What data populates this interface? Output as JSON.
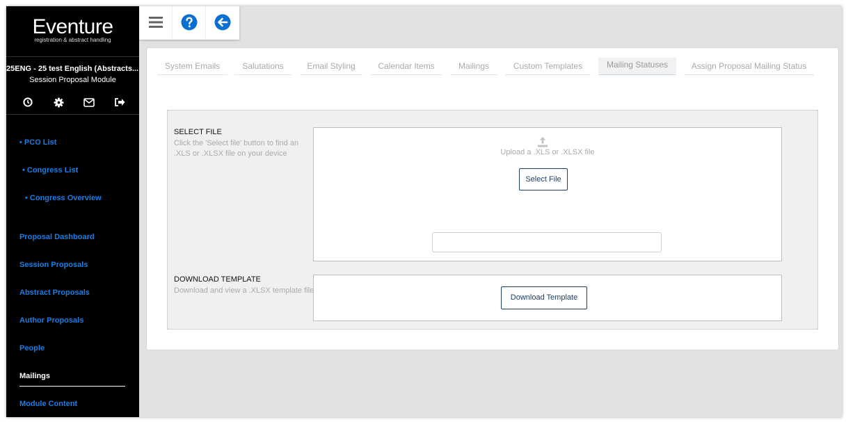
{
  "brand": {
    "name": "Eventure",
    "tagline": "registration & abstract handling"
  },
  "sidebar": {
    "congress": "25ENG - 25 test English (Abstracts...",
    "module": "Session Proposal Module",
    "icons": [
      "clock-icon",
      "gear-icon",
      "envelope-icon",
      "logout-icon"
    ],
    "nav": [
      {
        "label": "• PCO List"
      },
      {
        "label": "• Congress List"
      },
      {
        "label": "• Congress Overview"
      },
      {
        "label": "Proposal Dashboard"
      },
      {
        "label": "Session Proposals"
      },
      {
        "label": "Abstract Proposals"
      },
      {
        "label": "Author Proposals"
      },
      {
        "label": "People"
      },
      {
        "label": "Mailings",
        "active": true
      },
      {
        "label": "Module Content"
      }
    ]
  },
  "toolbar": {
    "icons": [
      "menu-icon",
      "help-icon",
      "back-icon"
    ]
  },
  "tabs": [
    {
      "label": "System Emails"
    },
    {
      "label": "Salutations"
    },
    {
      "label": "Email Styling"
    },
    {
      "label": "Calendar Items"
    },
    {
      "label": "Mailings"
    },
    {
      "label": "Custom Templates"
    },
    {
      "label": "Mailing Statuses",
      "active": true
    },
    {
      "label": "Assign Proposal Mailing Status"
    }
  ],
  "select_file": {
    "title": "SELECT FILE",
    "description": "Click the 'Select file' button to find an .XLS or .XLSX file on your device",
    "upload_hint": "Upload a .XLS or .XLSX file",
    "button": "Select File",
    "file_value": ""
  },
  "download_template": {
    "title": "DOWNLOAD TEMPLATE",
    "description": "Download and view a .XLSX template file",
    "button": "Download Template"
  },
  "colors": {
    "sidebar_bg": "#000000",
    "link": "#1a7de3",
    "help_icon": "#0a6fd1",
    "button_border": "#1d3f6b"
  }
}
